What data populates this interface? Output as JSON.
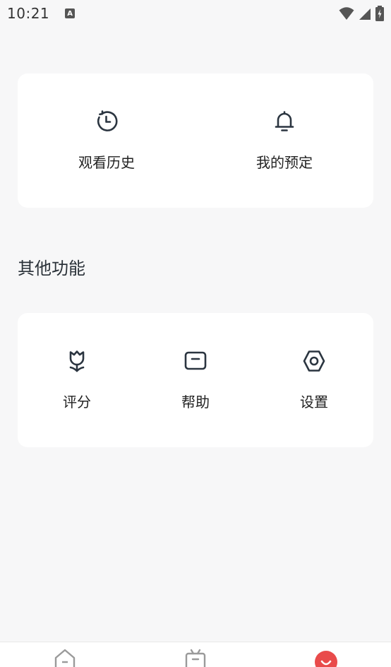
{
  "status_bar": {
    "time": "10:21",
    "notification_badge": "A",
    "icons": [
      "wifi-icon",
      "signal-icon",
      "battery-icon"
    ]
  },
  "quick_actions": [
    {
      "label": "观看历史",
      "icon": "history-clock-icon"
    },
    {
      "label": "我的预定",
      "icon": "bell-icon"
    }
  ],
  "other_section": {
    "title": "其他功能",
    "items": [
      {
        "label": "评分",
        "icon": "tulip-flower-icon"
      },
      {
        "label": "帮助",
        "icon": "message-box-icon"
      },
      {
        "label": "设置",
        "icon": "hexagon-settings-icon"
      }
    ]
  },
  "bottom_nav": {
    "items": [
      {
        "icon": "home-icon"
      },
      {
        "icon": "tv-icon"
      },
      {
        "icon": "profile-smile-icon",
        "active": true
      }
    ],
    "accent_color": "#e94b4b"
  }
}
